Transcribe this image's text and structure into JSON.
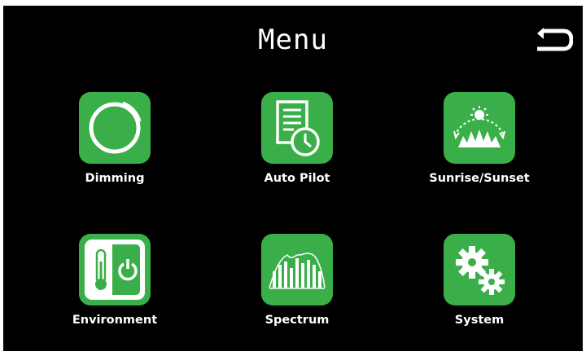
{
  "header": {
    "title": "Menu",
    "back_icon": "back-arrow-icon"
  },
  "colors": {
    "background": "#000000",
    "tile": "#3aaf49",
    "text": "#ffffff"
  },
  "menu": {
    "items": [
      {
        "label": "Dimming",
        "icon": "dimming-dial-icon"
      },
      {
        "label": "Auto Pilot",
        "icon": "schedule-clock-icon"
      },
      {
        "label": "Sunrise/Sunset",
        "icon": "sunrise-sunset-icon"
      },
      {
        "label": "Environment",
        "icon": "thermometer-power-icon"
      },
      {
        "label": "Spectrum",
        "icon": "spectrum-bars-icon"
      },
      {
        "label": "System",
        "icon": "gears-icon"
      }
    ]
  }
}
